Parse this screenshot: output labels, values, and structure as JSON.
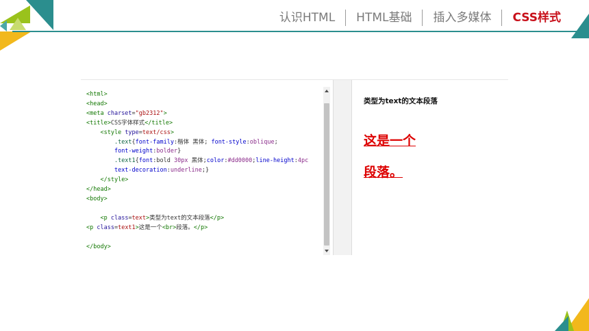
{
  "nav": {
    "items": [
      "认识HTML",
      "HTML基础",
      "插入多媒体",
      "CSS样式"
    ],
    "active_index": 3,
    "active_color": "#c8101a"
  },
  "colors": {
    "teal": "#2b8e8e",
    "green": "#9ac21c",
    "yellow": "#f2b81c"
  },
  "code_lines": [
    [
      [
        "t",
        "<html>"
      ]
    ],
    [
      [
        "t",
        "<head>"
      ]
    ],
    [
      [
        "t",
        "<meta "
      ],
      [
        "a",
        "charset"
      ],
      [
        "x",
        "="
      ],
      [
        "s",
        "\"gb2312\""
      ],
      [
        "t",
        ">"
      ]
    ],
    [
      [
        "t",
        "<title>"
      ],
      [
        "x",
        "CSS字体样式"
      ],
      [
        "t",
        "</title>"
      ]
    ],
    [
      [
        "x",
        "    "
      ],
      [
        "t",
        "<style "
      ],
      [
        "a",
        "type"
      ],
      [
        "x",
        "="
      ],
      [
        "s",
        "text/css"
      ],
      [
        "t",
        ">"
      ]
    ],
    [
      [
        "x",
        "        "
      ],
      [
        "n",
        ".text"
      ],
      [
        "x",
        "{"
      ],
      [
        "p",
        "font-family"
      ],
      [
        "x",
        ":楷体 黑体; "
      ],
      [
        "p",
        "font-style"
      ],
      [
        "x",
        ":"
      ],
      [
        "v",
        "oblique"
      ],
      [
        "x",
        ";"
      ]
    ],
    [
      [
        "x",
        "        "
      ],
      [
        "p",
        "font-weight"
      ],
      [
        "x",
        ":"
      ],
      [
        "v",
        "bolder"
      ],
      [
        "x",
        "}"
      ]
    ],
    [
      [
        "x",
        "        "
      ],
      [
        "n",
        ".text1"
      ],
      [
        "x",
        "{"
      ],
      [
        "p",
        "font"
      ],
      [
        "x",
        ":bold "
      ],
      [
        "v",
        "30px"
      ],
      [
        "x",
        " 黑体;"
      ],
      [
        "p",
        "color"
      ],
      [
        "x",
        ":"
      ],
      [
        "v",
        "#dd0000"
      ],
      [
        "x",
        ";"
      ],
      [
        "p",
        "line-height"
      ],
      [
        "x",
        ":"
      ],
      [
        "v",
        "4pc"
      ]
    ],
    [
      [
        "x",
        "        "
      ],
      [
        "p",
        "text-decoration"
      ],
      [
        "x",
        ":"
      ],
      [
        "v",
        "underline"
      ],
      [
        "x",
        ";}"
      ]
    ],
    [
      [
        "x",
        "    "
      ],
      [
        "t",
        "</style>"
      ]
    ],
    [
      [
        "t",
        "</head>"
      ]
    ],
    [
      [
        "t",
        "<body>"
      ]
    ],
    [
      [
        "x",
        ""
      ]
    ],
    [
      [
        "x",
        "    "
      ],
      [
        "t",
        "<p "
      ],
      [
        "a",
        "class"
      ],
      [
        "x",
        "="
      ],
      [
        "s",
        "text"
      ],
      [
        "t",
        ">"
      ],
      [
        "x",
        "类型为text的文本段落"
      ],
      [
        "t",
        "</p>"
      ]
    ],
    [
      [
        "t",
        "<p "
      ],
      [
        "a",
        "class"
      ],
      [
        "x",
        "="
      ],
      [
        "s",
        "text1"
      ],
      [
        "t",
        ">"
      ],
      [
        "x",
        "这是一个"
      ],
      [
        "t",
        "<br>"
      ],
      [
        "x",
        "段落。"
      ],
      [
        "t",
        "</p>"
      ]
    ],
    [
      [
        "x",
        ""
      ]
    ],
    [
      [
        "t",
        "</body>"
      ]
    ]
  ],
  "preview": {
    "text_paragraph": "类型为text的文本段落",
    "text1_line1": "这是一个",
    "text1_line2": "段落。",
    "text1_color": "#dd0000"
  }
}
